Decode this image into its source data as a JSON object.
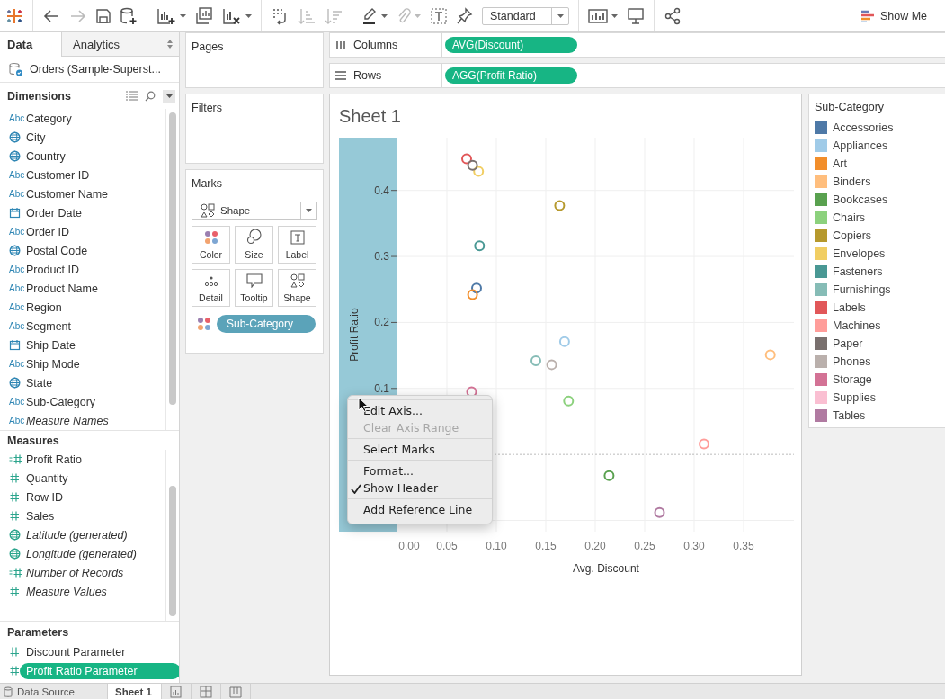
{
  "toolbar": {
    "mark_type": "Standard",
    "show_me": "Show Me"
  },
  "data_pane": {
    "tabs": [
      {
        "label": "Data",
        "selected": true
      },
      {
        "label": "Analytics",
        "selected": false
      }
    ],
    "data_source": "Orders (Sample-Superst...",
    "dimensions": {
      "title": "Dimensions",
      "fields": [
        {
          "name": "Category",
          "kind": "text",
          "glyph": "Abc",
          "generated": false
        },
        {
          "name": "City",
          "kind": "geo",
          "generated": false
        },
        {
          "name": "Country",
          "kind": "geo",
          "generated": false
        },
        {
          "name": "Customer ID",
          "kind": "text",
          "glyph": "Abc",
          "generated": false
        },
        {
          "name": "Customer Name",
          "kind": "text",
          "glyph": "Abc",
          "generated": false
        },
        {
          "name": "Order Date",
          "kind": "date",
          "generated": false
        },
        {
          "name": "Order ID",
          "kind": "text",
          "glyph": "Abc",
          "generated": false
        },
        {
          "name": "Postal Code",
          "kind": "geo",
          "generated": false
        },
        {
          "name": "Product ID",
          "kind": "text",
          "glyph": "Abc",
          "generated": false
        },
        {
          "name": "Product Name",
          "kind": "text",
          "glyph": "Abc",
          "generated": false
        },
        {
          "name": "Region",
          "kind": "text",
          "glyph": "Abc",
          "generated": false
        },
        {
          "name": "Segment",
          "kind": "text",
          "glyph": "Abc",
          "generated": false
        },
        {
          "name": "Ship Date",
          "kind": "date",
          "generated": false
        },
        {
          "name": "Ship Mode",
          "kind": "text",
          "glyph": "Abc",
          "generated": false
        },
        {
          "name": "State",
          "kind": "geo",
          "generated": false
        },
        {
          "name": "Sub-Category",
          "kind": "text",
          "glyph": "Abc",
          "generated": false
        },
        {
          "name": "Measure Names",
          "kind": "text",
          "glyph": "Abc",
          "generated": true
        }
      ]
    },
    "measures": {
      "title": "Measures",
      "fields": [
        {
          "name": "Profit Ratio",
          "kind": "calc",
          "generated": false
        },
        {
          "name": "Quantity",
          "kind": "number",
          "generated": false
        },
        {
          "name": "Row ID",
          "kind": "number",
          "generated": false
        },
        {
          "name": "Sales",
          "kind": "number",
          "generated": false
        },
        {
          "name": "Latitude (generated)",
          "kind": "geo",
          "generated": true
        },
        {
          "name": "Longitude (generated)",
          "kind": "geo",
          "generated": true
        },
        {
          "name": "Number of Records",
          "kind": "calc",
          "generated": true
        },
        {
          "name": "Measure Values",
          "kind": "number",
          "generated": true
        }
      ]
    },
    "parameters": {
      "title": "Parameters",
      "fields": [
        {
          "name": "Discount Parameter",
          "kind": "number",
          "selected": false
        },
        {
          "name": "Profit Ratio Parameter",
          "kind": "number",
          "selected": true
        }
      ]
    }
  },
  "cards": {
    "pages": {
      "title": "Pages"
    },
    "filters": {
      "title": "Filters"
    },
    "marks": {
      "title": "Marks",
      "mark_type": "Shape",
      "buttons": [
        {
          "label": "Color",
          "kind": "color"
        },
        {
          "label": "Size",
          "kind": "size"
        },
        {
          "label": "Label",
          "kind": "label"
        },
        {
          "label": "Detail",
          "kind": "detail"
        },
        {
          "label": "Tooltip",
          "kind": "tooltip"
        },
        {
          "label": "Shape",
          "kind": "shape"
        }
      ],
      "pills": [
        {
          "label": "Sub-Category",
          "kind": "color"
        }
      ]
    }
  },
  "shelves": [
    {
      "label": "Columns",
      "kind": "columns",
      "pill": "AVG(Discount)"
    },
    {
      "label": "Rows",
      "kind": "rows",
      "pill": "AGG(Profit Ratio)"
    }
  ],
  "view": {
    "sheet_title": "Sheet 1",
    "axis_selected": true,
    "chart_data": {
      "type": "scatter",
      "xlabel": "Avg. Discount",
      "ylabel": "Profit Ratio",
      "xlim": [
        0,
        0.4
      ],
      "ylim": [
        -0.117,
        0.48
      ],
      "xticks": [
        {
          "value": 0,
          "label": "0.00"
        },
        {
          "value": 0.05,
          "label": "0.05"
        },
        {
          "value": 0.1,
          "label": "0.10"
        },
        {
          "value": 0.15,
          "label": "0.15"
        },
        {
          "value": 0.2,
          "label": "0.20"
        },
        {
          "value": 0.25,
          "label": "0.25"
        },
        {
          "value": 0.3,
          "label": "0.30"
        },
        {
          "value": 0.35,
          "label": "0.35"
        }
      ],
      "yticks": [
        0.1,
        0.2,
        0.3,
        0.4
      ],
      "grid": true,
      "ref_lines": [
        {
          "axis": "y",
          "value": 0
        }
      ],
      "series": [
        {
          "color": "#4e79a7",
          "x": [
            0.08
          ],
          "values": [
            0.252
          ]
        },
        {
          "color": "#a0cbe8",
          "x": [
            0.169
          ],
          "values": [
            0.171
          ]
        },
        {
          "color": "#f28e2b",
          "x": [
            0.076
          ],
          "values": [
            0.242
          ]
        },
        {
          "color": "#ffbe7d",
          "x": [
            0.377
          ],
          "values": [
            0.151
          ]
        },
        {
          "color": "#59a14f",
          "x": [
            0.214
          ],
          "values": [
            -0.032
          ]
        },
        {
          "color": "#8cd17d",
          "x": [
            0.173
          ],
          "values": [
            0.081
          ]
        },
        {
          "color": "#b6992d",
          "x": [
            0.164
          ],
          "values": [
            0.377
          ]
        },
        {
          "color": "#f1ce63",
          "x": [
            0.082
          ],
          "values": [
            0.429
          ]
        },
        {
          "color": "#499894",
          "x": [
            0.083
          ],
          "values": [
            0.316
          ]
        },
        {
          "color": "#86bcb6",
          "x": [
            0.14
          ],
          "values": [
            0.142
          ]
        },
        {
          "color": "#e15759",
          "x": [
            0.07
          ],
          "values": [
            0.448
          ]
        },
        {
          "color": "#ff9d9a",
          "x": [
            0.31
          ],
          "values": [
            0.016
          ]
        },
        {
          "color": "#79706e",
          "x": [
            0.076
          ],
          "values": [
            0.438
          ]
        },
        {
          "color": "#bab0ac",
          "x": [
            0.156
          ],
          "values": [
            0.136
          ]
        },
        {
          "color": "#d37295",
          "x": [
            0.075
          ],
          "values": [
            0.095
          ]
        },
        {
          "color": "#b07aa1",
          "x": [
            0.265
          ],
          "values": [
            -0.088
          ]
        }
      ]
    },
    "legend": {
      "title": "Sub-Category",
      "items": [
        {
          "label": "Accessories",
          "color": "#4e79a7"
        },
        {
          "label": "Appliances",
          "color": "#a0cbe8"
        },
        {
          "label": "Art",
          "color": "#f28e2b"
        },
        {
          "label": "Binders",
          "color": "#ffbe7d"
        },
        {
          "label": "Bookcases",
          "color": "#59a14f"
        },
        {
          "label": "Chairs",
          "color": "#8cd17d"
        },
        {
          "label": "Copiers",
          "color": "#b6992d"
        },
        {
          "label": "Envelopes",
          "color": "#f1ce63"
        },
        {
          "label": "Fasteners",
          "color": "#499894"
        },
        {
          "label": "Furnishings",
          "color": "#86bcb6"
        },
        {
          "label": "Labels",
          "color": "#e15759"
        },
        {
          "label": "Machines",
          "color": "#ff9d9a"
        },
        {
          "label": "Paper",
          "color": "#79706e"
        },
        {
          "label": "Phones",
          "color": "#bab0ac"
        },
        {
          "label": "Storage",
          "color": "#d37295"
        },
        {
          "label": "Supplies",
          "color": "#fabfd2"
        },
        {
          "label": "Tables",
          "color": "#b07aa1"
        }
      ]
    },
    "context_menu": {
      "groups": [
        {
          "items": [
            {
              "label": "Edit Axis...",
              "disabled": false,
              "checked": false
            },
            {
              "label": "Clear Axis Range",
              "disabled": true,
              "checked": false
            }
          ]
        },
        {
          "items": [
            {
              "label": "Select Marks",
              "disabled": false,
              "checked": false
            }
          ]
        },
        {
          "items": [
            {
              "label": "Format...",
              "disabled": false,
              "checked": false
            },
            {
              "label": "Show Header",
              "disabled": false,
              "checked": true
            }
          ]
        },
        {
          "items": [
            {
              "label": "Add Reference Line",
              "disabled": false,
              "checked": false
            }
          ]
        }
      ]
    }
  },
  "sheet_tabs": [
    {
      "label": "Data Source",
      "kind": "datasource",
      "selected": false
    },
    {
      "label": "Sheet 1",
      "kind": "sheet",
      "selected": true
    }
  ]
}
